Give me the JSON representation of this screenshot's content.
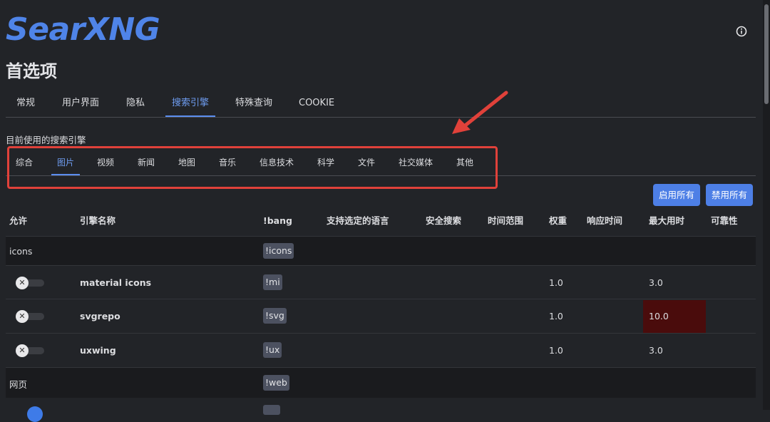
{
  "app": {
    "logo": "SearXNG",
    "page_title": "首选项",
    "info_icon": "info-circle-icon"
  },
  "main_tabs": [
    {
      "label": "常规",
      "active": false
    },
    {
      "label": "用户界面",
      "active": false
    },
    {
      "label": "隐私",
      "active": false
    },
    {
      "label": "搜索引擎",
      "active": true
    },
    {
      "label": "特殊查询",
      "active": false
    },
    {
      "label": "COOKIE",
      "active": false
    }
  ],
  "section_label": "目前使用的搜索引擎",
  "category_tabs": [
    {
      "label": "综合",
      "active": false
    },
    {
      "label": "图片",
      "active": true
    },
    {
      "label": "视频",
      "active": false
    },
    {
      "label": "新闻",
      "active": false
    },
    {
      "label": "地图",
      "active": false
    },
    {
      "label": "音乐",
      "active": false
    },
    {
      "label": "信息技术",
      "active": false
    },
    {
      "label": "科学",
      "active": false
    },
    {
      "label": "文件",
      "active": false
    },
    {
      "label": "社交媒体",
      "active": false
    },
    {
      "label": "其他",
      "active": false
    }
  ],
  "buttons": {
    "enable_all": "启用所有",
    "disable_all": "禁用所有"
  },
  "table": {
    "headers": {
      "allow": "允许",
      "engine_name": "引擎名称",
      "bang": "!bang",
      "languages": "支持选定的语言",
      "safe_search": "安全搜索",
      "time_range": "时间范围",
      "weight": "权重",
      "response_time": "响应时间",
      "max_time": "最大用时",
      "reliability": "可靠性"
    },
    "groups": [
      {
        "name": "icons",
        "bang": "!icons"
      },
      {
        "name": "网页",
        "bang": "!web"
      }
    ],
    "engines": [
      {
        "name": "material icons",
        "bang": "!mi",
        "enabled": false,
        "weight": "1.0",
        "max_time": "3.0"
      },
      {
        "name": "svgrepo",
        "bang": "!svg",
        "enabled": false,
        "weight": "1.0",
        "max_time": "10.0"
      },
      {
        "name": "uxwing",
        "bang": "!ux",
        "enabled": false,
        "weight": "1.0",
        "max_time": "3.0"
      }
    ]
  },
  "colors": {
    "accent": "#4d7fe6",
    "active_tab": "#6e9cf0",
    "highlight_red": "#e0413a",
    "max_time_warning_bg": "#4a0c0c",
    "background": "#222428"
  }
}
